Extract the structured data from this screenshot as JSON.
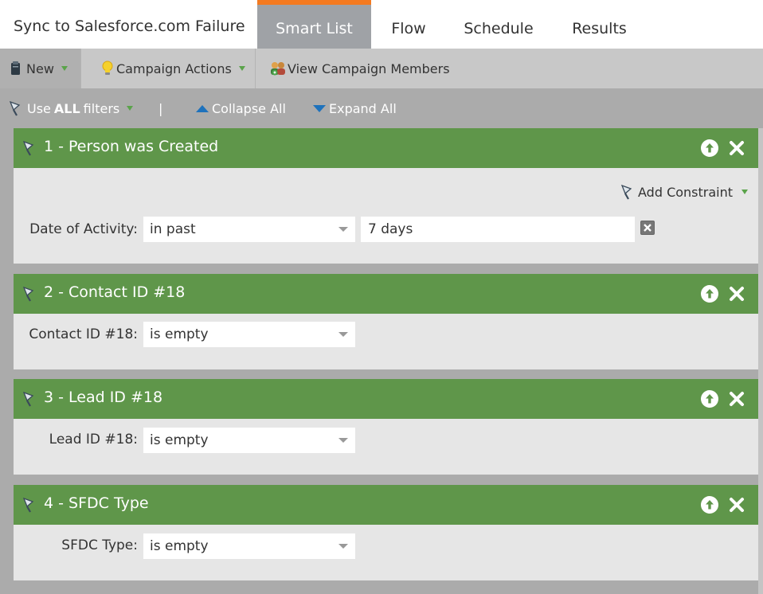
{
  "header": {
    "campaign_title": "Sync to Salesforce.com Failure",
    "tabs": [
      {
        "label": "Smart List",
        "active": true
      },
      {
        "label": "Flow"
      },
      {
        "label": "Schedule"
      },
      {
        "label": "Results"
      }
    ]
  },
  "toolbar": {
    "new_label": "New",
    "campaign_actions_label": "Campaign Actions",
    "view_members_label": "View Campaign Members"
  },
  "filter_bar": {
    "use_prefix": "Use",
    "use_bold": "ALL",
    "use_suffix": "filters",
    "separator": "|",
    "collapse_label": "Collapse All",
    "expand_label": "Expand All"
  },
  "filters": [
    {
      "title": "1 - Person was Created",
      "add_constraint_label": "Add Constraint",
      "field_label": "Date of Activity:",
      "operator": "in past",
      "value": "7 days"
    },
    {
      "title": "2 - Contact ID #18",
      "field_label": "Contact ID #18:",
      "operator": "is empty"
    },
    {
      "title": "3 - Lead ID #18",
      "field_label": "Lead ID #18:",
      "operator": "is empty"
    },
    {
      "title": "4 - SFDC Type",
      "field_label": "SFDC Type:",
      "operator": "is empty"
    }
  ],
  "colors": {
    "card_header": "#5f964a",
    "active_tab": "#9fa2a6",
    "tab_accent": "#f47a20",
    "link_blue": "#1e72bc"
  }
}
